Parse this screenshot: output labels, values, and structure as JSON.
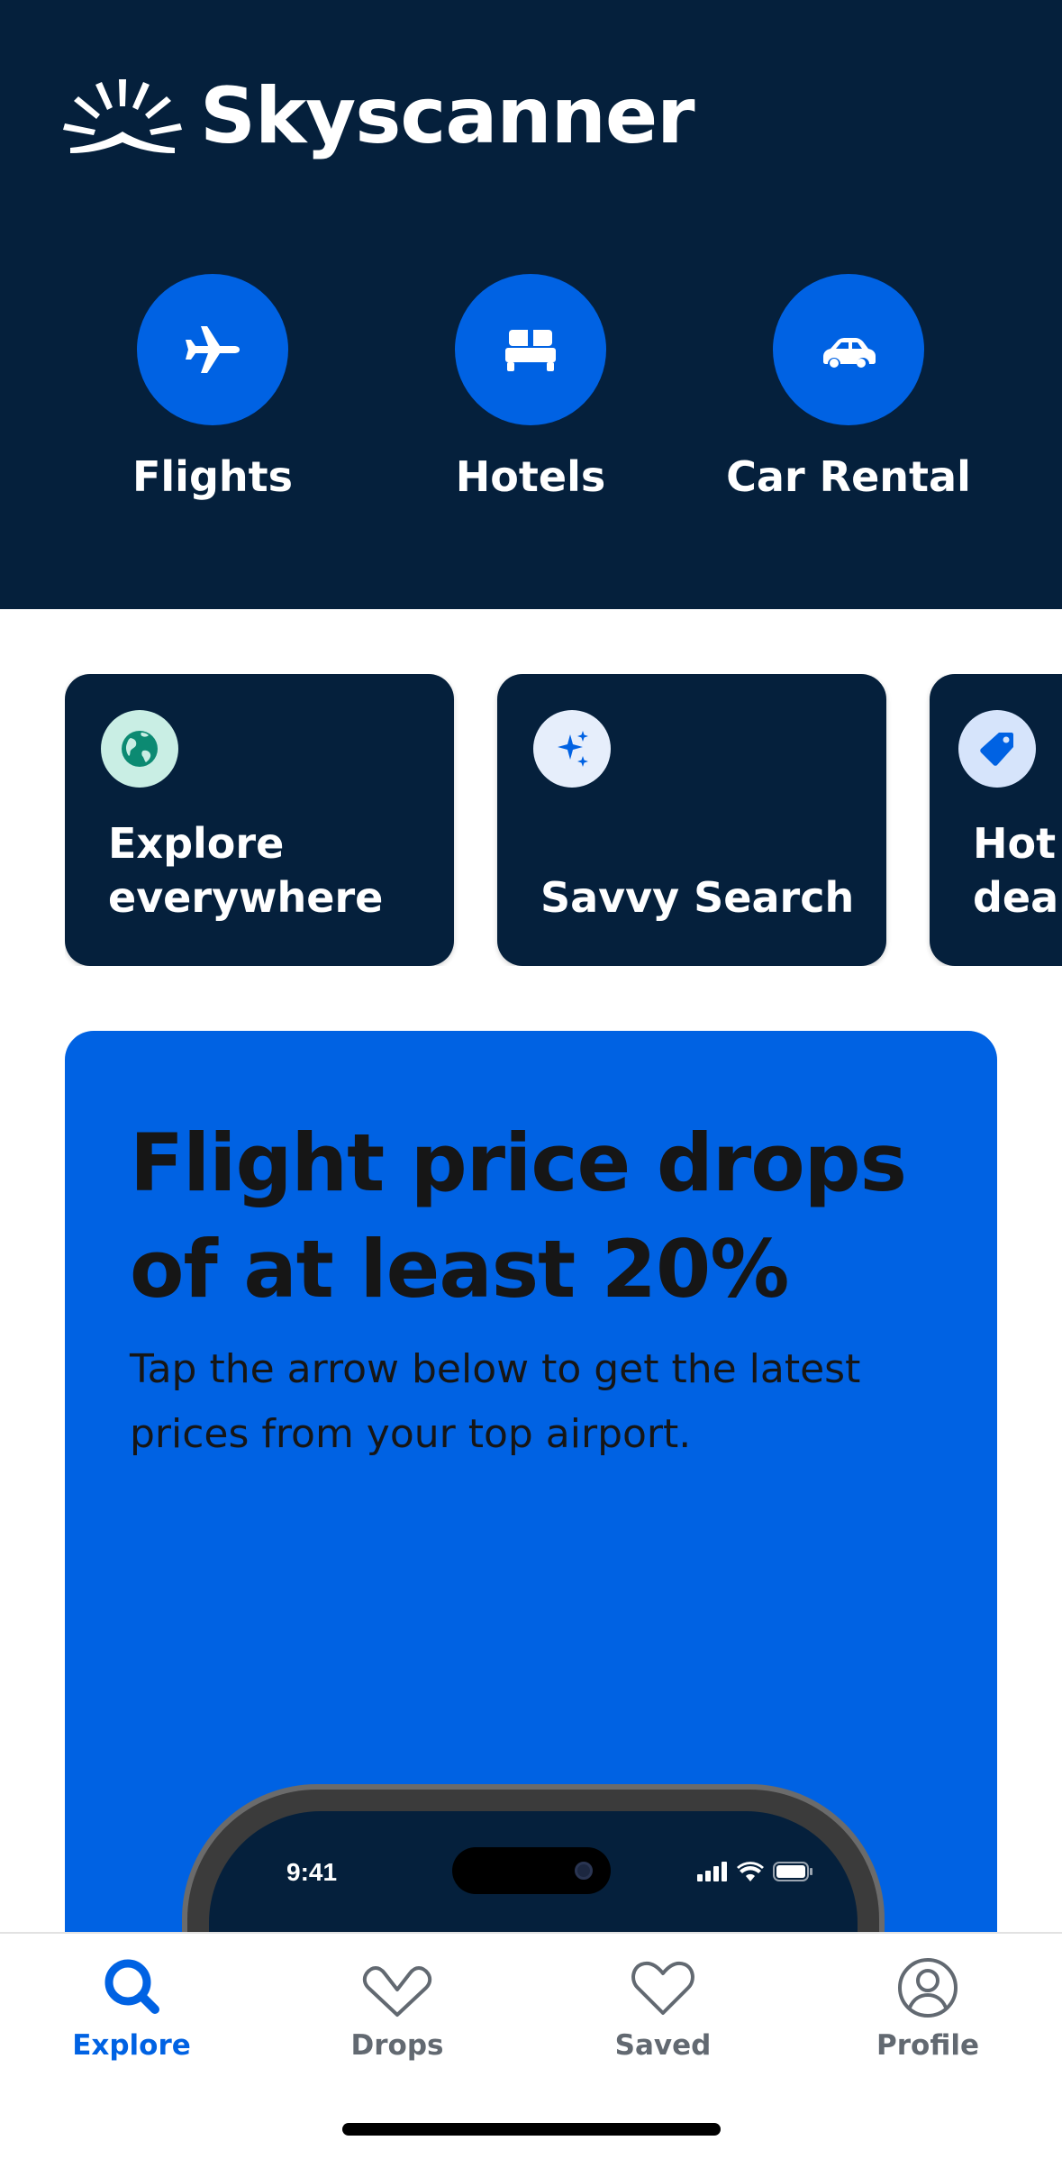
{
  "app": {
    "brand": "Skyscanner"
  },
  "categories": [
    {
      "label": "Flights",
      "icon": "airplane-icon"
    },
    {
      "label": "Hotels",
      "icon": "bed-icon"
    },
    {
      "label": "Car Rental",
      "icon": "car-icon"
    }
  ],
  "cards": [
    {
      "title": "Explore\neverywhere",
      "icon": "globe-icon"
    },
    {
      "title": "Savvy Search",
      "icon": "sparkle-icon"
    },
    {
      "title": "Hot \ndeals",
      "icon": "tag-icon"
    }
  ],
  "promo": {
    "title": "Flight price drops of at least 20%",
    "body": "Tap the arrow below to get the latest prices from your top airport.",
    "phone_time": "9:41"
  },
  "tabbar": {
    "items": [
      {
        "label": "Explore",
        "icon": "search-icon",
        "active": true
      },
      {
        "label": "Drops",
        "icon": "drops-icon",
        "active": false
      },
      {
        "label": "Saved",
        "icon": "heart-icon",
        "active": false
      },
      {
        "label": "Profile",
        "icon": "profile-icon",
        "active": false
      }
    ]
  },
  "colors": {
    "navy": "#05203c",
    "brand_blue": "#0062e3",
    "text_dark": "#161616",
    "tab_inactive": "#626971"
  }
}
